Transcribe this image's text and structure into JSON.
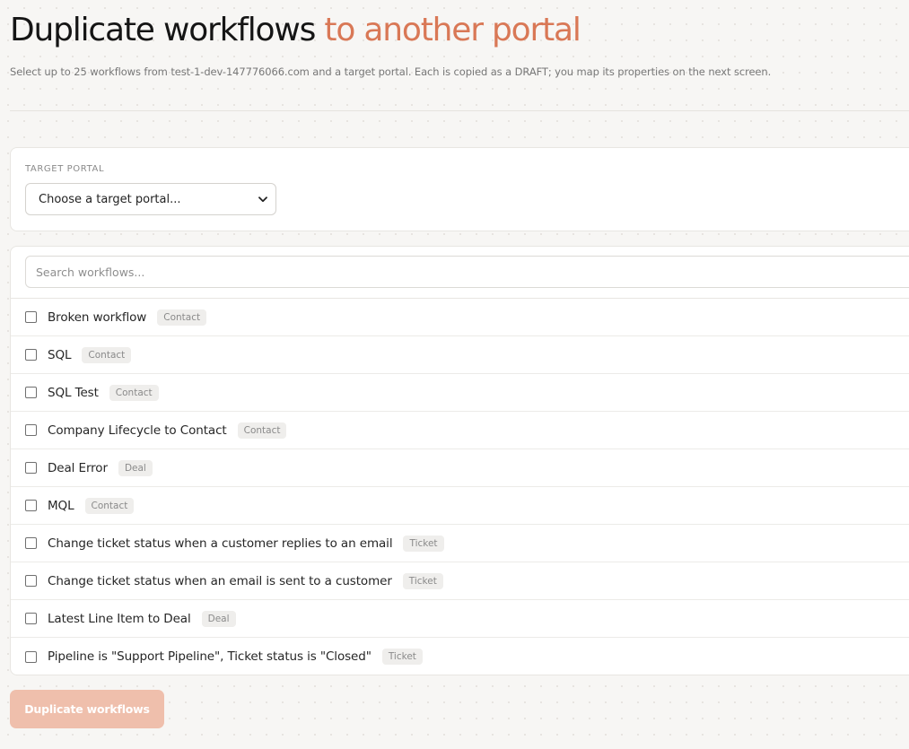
{
  "header": {
    "title_main": "Duplicate workflows",
    "title_accent": "to another portal",
    "subtitle": "Select up to 25 workflows from test-1-dev-147776066.com and a target portal. Each is copied as a DRAFT; you map its properties on the next screen."
  },
  "portal": {
    "label": "TARGET PORTAL",
    "selected": "Choose a target portal..."
  },
  "search": {
    "placeholder": "Search workflows..."
  },
  "workflows": [
    {
      "name": "Broken workflow",
      "type": "Contact",
      "checked": false
    },
    {
      "name": "SQL",
      "type": "Contact",
      "checked": false
    },
    {
      "name": "SQL Test",
      "type": "Contact",
      "checked": false
    },
    {
      "name": "Company Lifecycle to Contact",
      "type": "Contact",
      "checked": false
    },
    {
      "name": "Deal Error",
      "type": "Deal",
      "checked": false
    },
    {
      "name": "MQL",
      "type": "Contact",
      "checked": false
    },
    {
      "name": "Change ticket status when a customer replies to an email",
      "type": "Ticket",
      "checked": false
    },
    {
      "name": "Change ticket status when an email is sent to a customer",
      "type": "Ticket",
      "checked": false
    },
    {
      "name": "Latest Line Item to Deal",
      "type": "Deal",
      "checked": false
    },
    {
      "name": "Pipeline is \"Support Pipeline\", Ticket status is \"Closed\"",
      "type": "Ticket",
      "checked": false
    }
  ],
  "actions": {
    "submit_label": "Duplicate workflows",
    "submit_disabled": true
  },
  "colors": {
    "accent": "#d97856",
    "button_disabled": "#efbfac",
    "background": "#f7f6f4"
  }
}
